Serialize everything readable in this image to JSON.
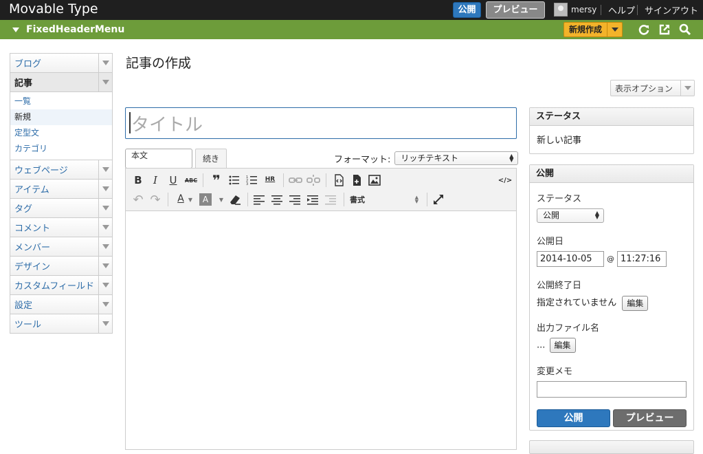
{
  "app": {
    "brand": "Movable Type"
  },
  "topbar": {
    "publish_label": "公開",
    "preview_label": "プレビュー",
    "username": "mersy",
    "help": "ヘルプ",
    "signout": "サインアウト"
  },
  "blogbar": {
    "blog_name": "FixedHeaderMenu",
    "new_label": "新規作成"
  },
  "sidebar": {
    "sections": [
      {
        "label": "ブログ"
      },
      {
        "label": "記事",
        "active": true
      },
      {
        "label": "ウェブページ"
      },
      {
        "label": "アイテム"
      },
      {
        "label": "タグ"
      },
      {
        "label": "コメント"
      },
      {
        "label": "メンバー"
      },
      {
        "label": "デザイン"
      },
      {
        "label": "カスタムフィールド"
      },
      {
        "label": "設定"
      },
      {
        "label": "ツール"
      }
    ],
    "entry_sub": [
      "一覧",
      "新規",
      "定型文",
      "カテゴリ"
    ]
  },
  "main": {
    "title": "記事の作成",
    "display_options": "表示オプション",
    "title_placeholder": "タイトル",
    "tab_body": "本文",
    "tab_more": "続き",
    "format_label": "フォーマット:",
    "format_value": "リッチテキスト",
    "block_format": "書式",
    "html_toggle": "</>"
  },
  "status_panel": {
    "heading": "ステータス",
    "value": "新しい記事"
  },
  "publish_panel": {
    "heading": "公開",
    "status_label": "ステータス",
    "status_value": "公開",
    "date_label": "公開日",
    "date_value": "2014-10-05",
    "at": "@",
    "time_value": "11:27:16",
    "end_label": "公開終了日",
    "end_value": "指定されていません",
    "edit": "編集",
    "file_label": "出力ファイル名",
    "file_value": "...",
    "memo_label": "変更メモ",
    "publish_btn": "公開",
    "preview_btn": "プレビュー"
  }
}
